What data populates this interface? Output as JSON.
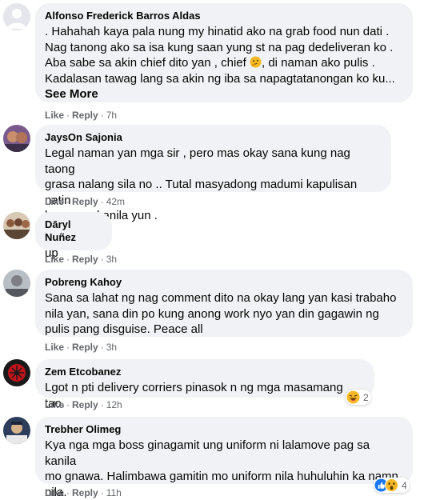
{
  "comments": [
    {
      "name": "Alfonso Frederick Barros Aldas",
      "lines": [
        ". Hahahah kaya pala nung my hinatid ako na grab food nun dati .",
        "Nag tanong ako sa isa kung saan yung st na pag dedeliveran ko .",
        "Aba sabe sa akin chief dito yan , chief",
        ", di naman ako pulis .",
        "Kadalasan tawag lang sa akin ng iba sa napagtatanongan ko ku..."
      ],
      "see_more": "See More",
      "like": "Like",
      "reply": "Reply",
      "time": "7h"
    },
    {
      "name": "JaysOn Sajonia",
      "lines": [
        "Legal naman yan mga sir , pero mas okay sana kung nag taong",
        "grasa nalang sila no .. Tutal masyadong madumi kapulisan natin",
        "bagay sa kanila yun ."
      ],
      "like": "Like",
      "reply": "Reply",
      "time": "42m"
    },
    {
      "name": "Dāryl Nuñez",
      "lines": [
        "up"
      ],
      "like": "Like",
      "reply": "Reply",
      "time": "3h"
    },
    {
      "name": "Pobreng Kahoy",
      "lines": [
        "Sana sa lahat ng nag comment dito na okay lang yan kasi trabaho",
        "nila yan, sana din po kung anong work nyo yan din gagawin ng",
        "pulis pang disguise. Peace all"
      ],
      "like": "Like",
      "reply": "Reply",
      "time": "3h"
    },
    {
      "name": "Zem Etcobanez",
      "lines": [
        "Lgot n pti delivery corriers pinasok n ng mga masamang tao."
      ],
      "like": "Like",
      "reply": "Reply",
      "time": "12h",
      "reaction_count": "2",
      "reaction_icon": "laugh-emoji-icon"
    },
    {
      "name": "Trebher Olimeg",
      "lines": [
        "Kya nga mga boss ginagamit ung uniform ni lalamove pag sa kanila",
        "mo gnawa. Halimbawa gamitin mo uniform nila huhuluhin ka namn",
        "nila."
      ],
      "like": "Like",
      "reply": "Reply",
      "time": "11h",
      "reaction_count": "4",
      "reaction_icon": "like-wow-emoji-icon"
    }
  ],
  "colors": {
    "bubble": "#f0f2f5",
    "meta": "#65676b",
    "like_blue": "#1877f2",
    "emoji_yellow": "#f7b928"
  }
}
